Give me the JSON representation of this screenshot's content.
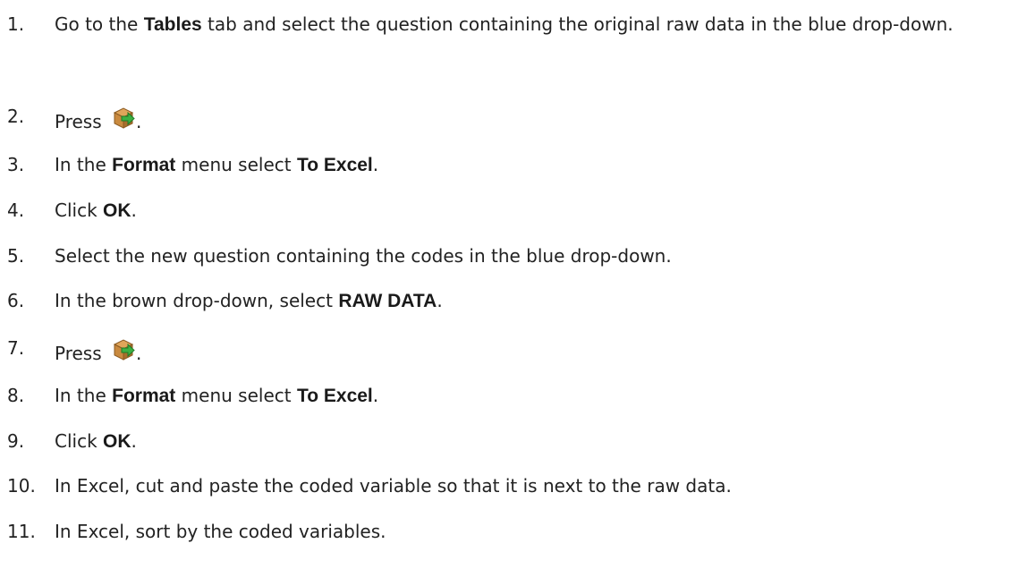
{
  "steps": [
    {
      "num": "1.",
      "parts": [
        "Go to the ",
        "Tables",
        " tab and select the question containing the original raw data in the blue drop-down."
      ]
    },
    {
      "num": "2.",
      "parts": [
        "Press ",
        "."
      ]
    },
    {
      "num": "3.",
      "parts": [
        "In the ",
        "Format",
        " menu select ",
        "To Excel",
        "."
      ]
    },
    {
      "num": "4.",
      "parts": [
        "Click ",
        "OK",
        "."
      ]
    },
    {
      "num": "5.",
      "parts": [
        "Select the new question containing the codes in the blue drop-down."
      ]
    },
    {
      "num": "6.",
      "parts": [
        "In the brown drop-down, select ",
        "RAW DATA",
        "."
      ]
    },
    {
      "num": "7.",
      "parts": [
        "Press ",
        "."
      ]
    },
    {
      "num": "8.",
      "parts": [
        "In the ",
        "Format",
        " menu select ",
        "To Excel",
        "."
      ]
    },
    {
      "num": "9.",
      "parts": [
        "Click ",
        "OK",
        "."
      ]
    },
    {
      "num": "10.",
      "parts": [
        "In Excel, cut and paste the coded variable so that it is next to the raw data."
      ]
    },
    {
      "num": "11.",
      "parts": [
        "In Excel, sort by the coded variables."
      ]
    }
  ],
  "icons": {
    "export": "export-box-icon"
  },
  "colors": {
    "box": "#c98a3f",
    "box_dark": "#8a5a22",
    "arrow": "#3cb043"
  }
}
